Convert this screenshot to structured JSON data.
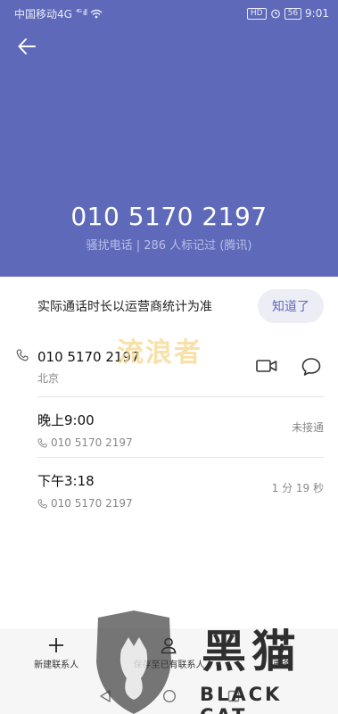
{
  "status_bar": {
    "carrier": "中国移动4G",
    "signal": "⁴ᴳ ıll",
    "hd": "HD",
    "battery": "56",
    "time": "9:01"
  },
  "header": {
    "number": "010 5170 2197",
    "tag": "骚扰电话 | 286 人标记过 (腾讯)"
  },
  "notice": {
    "text": "实际通话时长以运营商统计为准",
    "button": "知道了"
  },
  "contact": {
    "number": "010 5170 2197",
    "location": "北京"
  },
  "calls": [
    {
      "time": "晚上9:00",
      "number": "010 5170 2197",
      "status": "未接通"
    },
    {
      "time": "下午3:18",
      "number": "010 5170 2197",
      "status": "1 分 19 秒"
    }
  ],
  "bottom_bar": {
    "new_contact": "新建联系人",
    "save_existing": "保存至已有联系人",
    "more": "更多"
  },
  "watermark_text": "流浪者",
  "logo": {
    "cn": "黑猫",
    "en": "BLACK CAT"
  },
  "colors": {
    "header": "#5e6ab9",
    "accent": "#5e6ab9"
  }
}
